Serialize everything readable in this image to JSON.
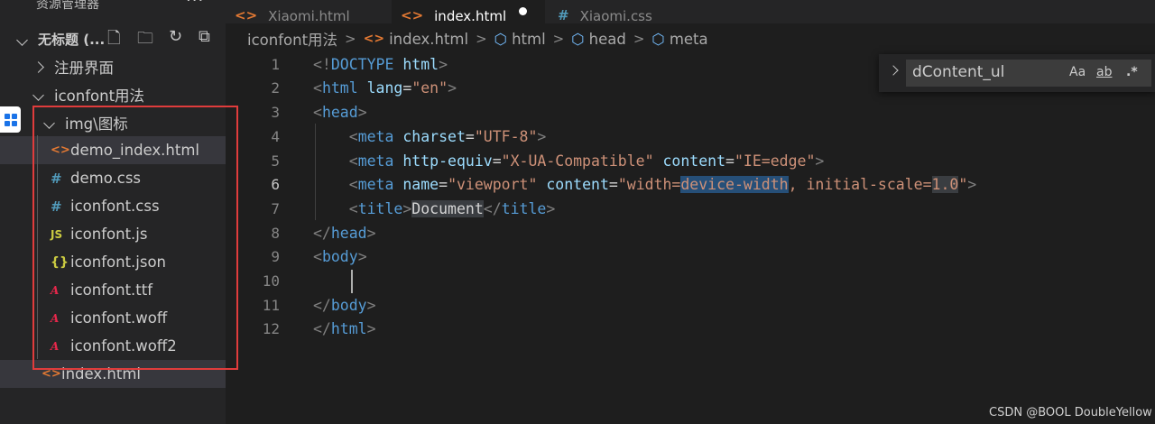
{
  "sidebar": {
    "title": "资源管理器",
    "more": "···",
    "workspace": "无标题 (...",
    "tree": [
      {
        "label": "注册界面",
        "type": "folder"
      },
      {
        "label": "iconfont用法",
        "type": "folder"
      },
      {
        "label": "img\\图标",
        "type": "folder"
      },
      {
        "label": "demo_index.html",
        "type": "html"
      },
      {
        "label": "demo.css",
        "type": "css"
      },
      {
        "label": "iconfont.css",
        "type": "css"
      },
      {
        "label": "iconfont.js",
        "type": "js"
      },
      {
        "label": "iconfont.json",
        "type": "json"
      },
      {
        "label": "iconfont.ttf",
        "type": "font"
      },
      {
        "label": "iconfont.woff",
        "type": "font"
      },
      {
        "label": "iconfont.woff2",
        "type": "font"
      },
      {
        "label": "index.html",
        "type": "html"
      }
    ]
  },
  "icons": {
    "html": "<>",
    "css": "#",
    "js": "JS",
    "json": "{}",
    "font": "A"
  },
  "tabs": [
    {
      "label": "Xiaomi.html",
      "icon": "<>",
      "active": false
    },
    {
      "label": "index.html",
      "icon": "<>",
      "active": true,
      "modified": true
    },
    {
      "label": "Xiaomi.css",
      "icon": "#",
      "active": false
    }
  ],
  "breadcrumb": [
    "iconfont用法",
    "index.html",
    "html",
    "head",
    "meta"
  ],
  "editor": {
    "line_numbers": [
      "1",
      "2",
      "3",
      "4",
      "5",
      "6",
      "7",
      "8",
      "9",
      "10",
      "11",
      "12"
    ],
    "current_line": 6
  },
  "find_widget": {
    "value": "dContent_ul",
    "match_case": "Aa",
    "whole_word": "ab",
    "regex": ".*"
  },
  "watermark": "CSDN @BOOL DoubleYellow"
}
